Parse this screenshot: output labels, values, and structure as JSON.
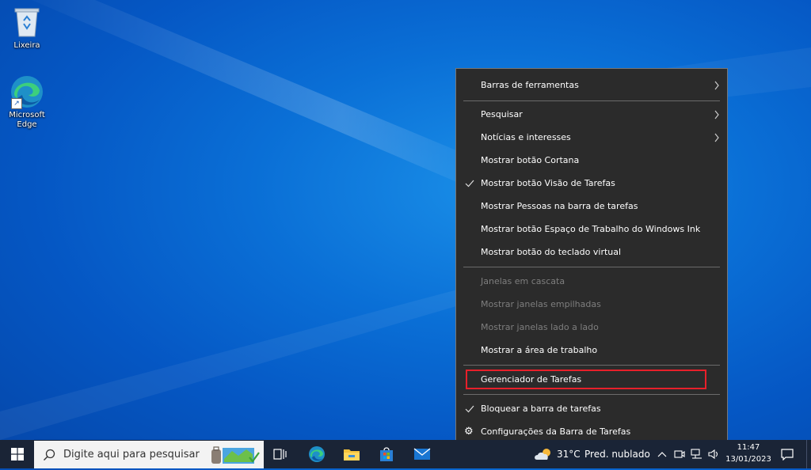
{
  "desktop": {
    "icons": [
      {
        "label": "Lixeira",
        "icon": "recycle-bin-icon"
      },
      {
        "label": "Microsoft Edge",
        "icon": "edge-icon"
      }
    ]
  },
  "context_menu": {
    "items": [
      {
        "label": "Barras de ferramentas",
        "submenu": true
      },
      {
        "label": "Pesquisar",
        "submenu": true
      },
      {
        "label": "Notícias e interesses",
        "submenu": true
      },
      {
        "label": "Mostrar botão Cortana"
      },
      {
        "label": "Mostrar botão Visão de Tarefas",
        "checked": true
      },
      {
        "label": "Mostrar Pessoas na barra de tarefas"
      },
      {
        "label": "Mostrar botão Espaço de Trabalho do Windows Ink"
      },
      {
        "label": "Mostrar botão do teclado virtual"
      },
      {
        "label": "Janelas em cascata",
        "disabled": true
      },
      {
        "label": "Mostrar janelas empilhadas",
        "disabled": true
      },
      {
        "label": "Mostrar janelas lado a lado",
        "disabled": true
      },
      {
        "label": "Mostrar a área de trabalho"
      },
      {
        "label": "Gerenciador de Tarefas",
        "highlighted": true
      },
      {
        "label": "Bloquear a barra de tarefas",
        "checked": true
      },
      {
        "label": "Configurações da Barra de Tarefas",
        "icon": "gear-icon"
      }
    ],
    "highlight_color": "#e8202a"
  },
  "taskbar": {
    "search_placeholder": "Digite aqui para pesquisar",
    "pinned": [
      "task-view-icon",
      "edge-icon",
      "file-explorer-icon",
      "store-icon",
      "mail-icon"
    ],
    "weather": {
      "temp": "31°C",
      "condition": "Pred. nublado"
    },
    "clock": {
      "time": "11:47",
      "date": "13/01/2023"
    },
    "background": "#1a2436"
  }
}
